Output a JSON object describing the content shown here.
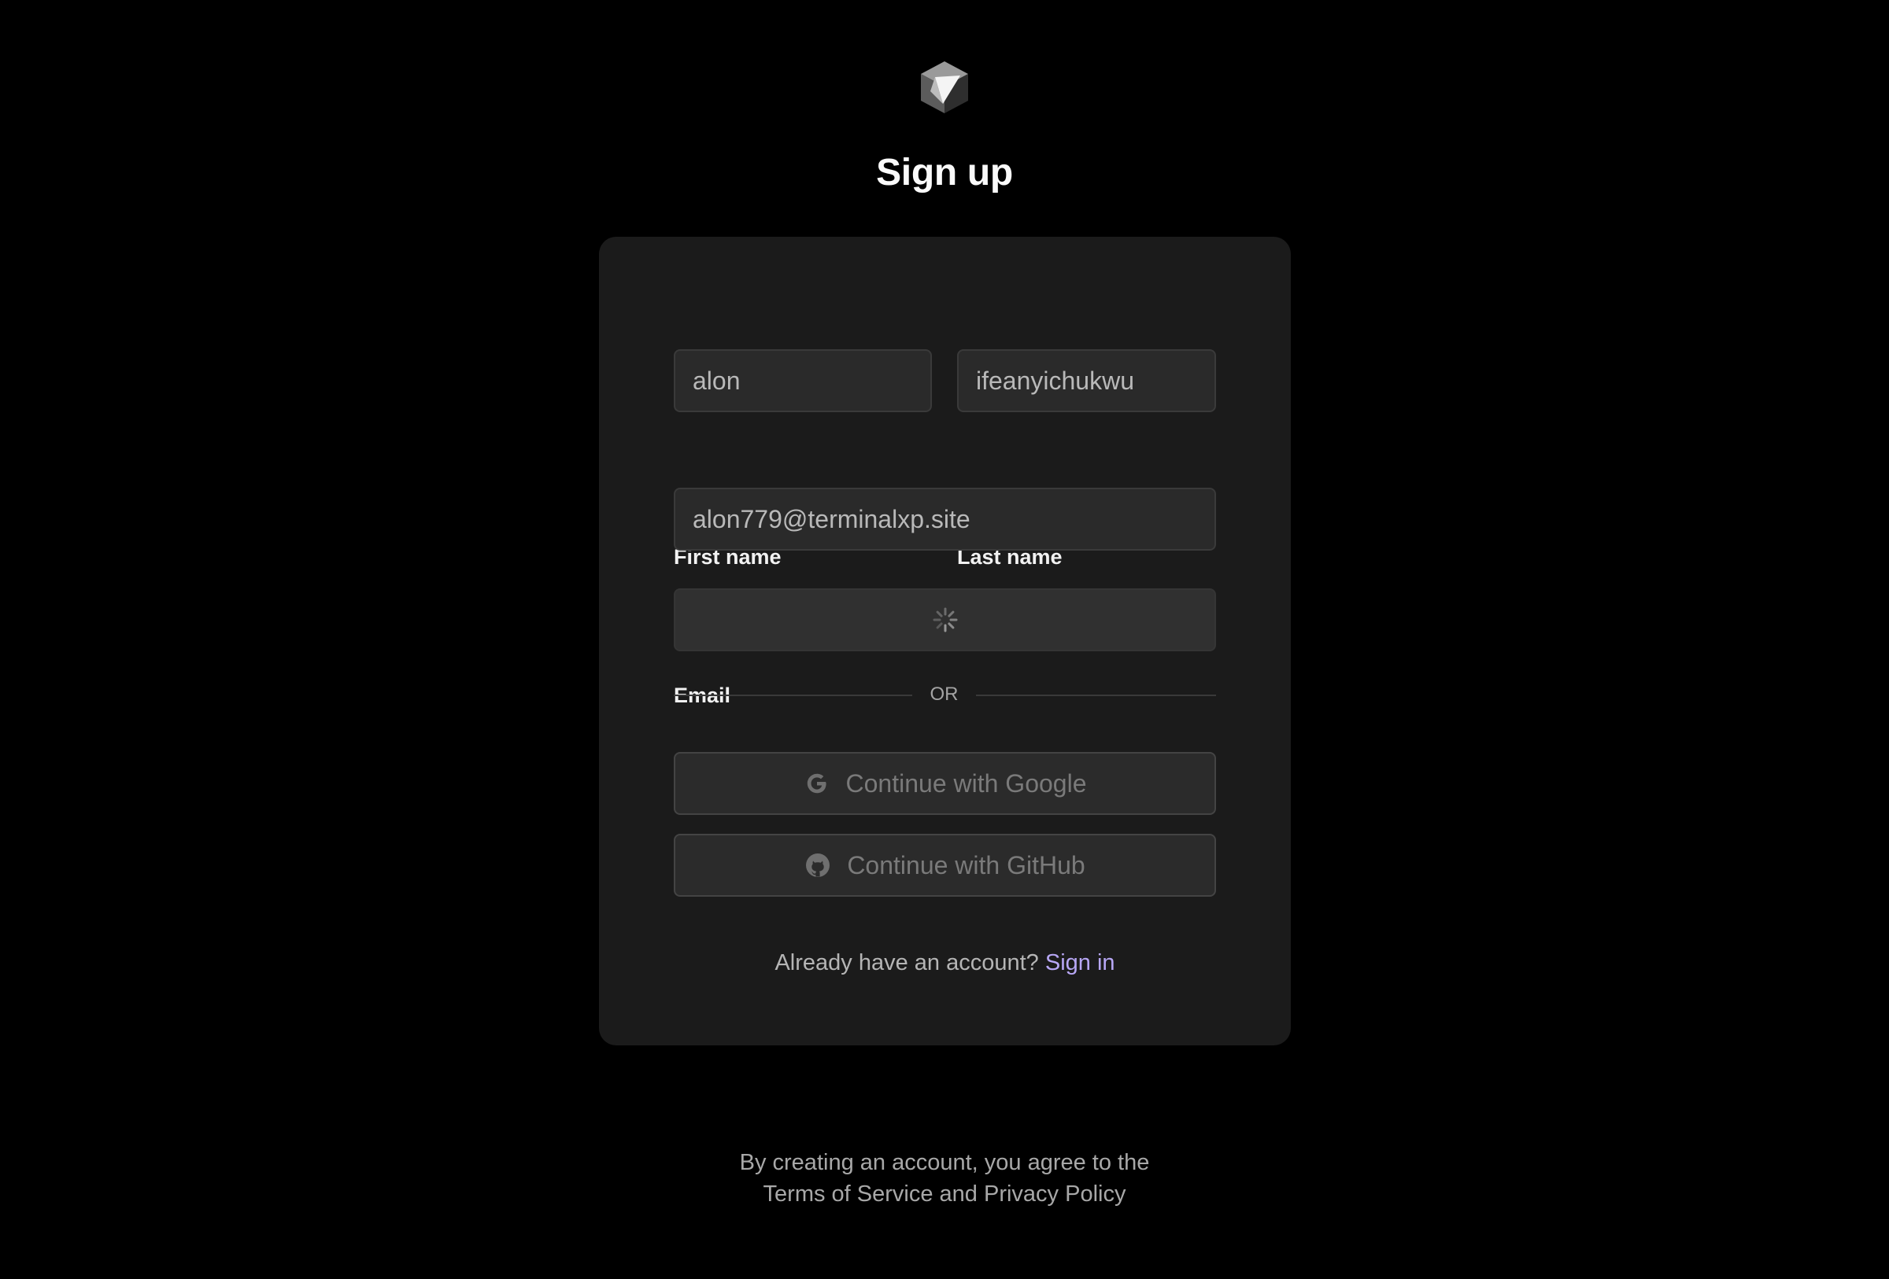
{
  "header": {
    "logo_icon": "cube-logo-icon",
    "title": "Sign up"
  },
  "form": {
    "first_name": {
      "label": "First name",
      "value": "alon"
    },
    "last_name": {
      "label": "Last name",
      "value": "ifeanyichukwu"
    },
    "email": {
      "label": "Email",
      "value": "alon779@terminalxp.site"
    },
    "submit": {
      "state": "loading",
      "icon": "spinner-icon"
    },
    "divider_text": "OR",
    "google": {
      "label": "Continue with Google",
      "icon": "google-icon"
    },
    "github": {
      "label": "Continue with GitHub",
      "icon": "github-icon"
    },
    "signin_prompt": "Already have an account?",
    "signin_link": "Sign in"
  },
  "footer": {
    "line1": "By creating an account, you agree to the",
    "line2": "Terms of Service and Privacy Policy"
  },
  "colors": {
    "background": "#000000",
    "card": "#1b1b1b",
    "input_bg": "#2a2a2a",
    "link_accent": "#b7a7f5"
  }
}
